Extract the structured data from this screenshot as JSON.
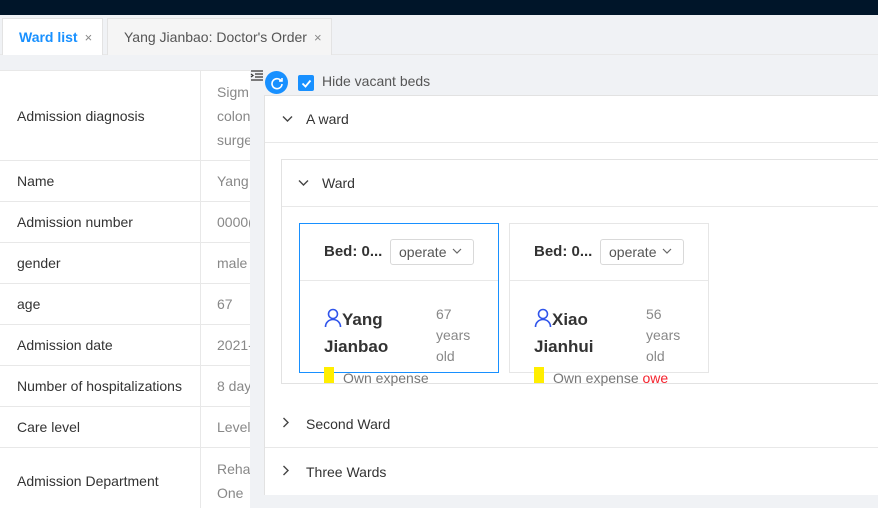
{
  "tabs": [
    {
      "label": "Ward list",
      "close": "×"
    },
    {
      "label": "Yang Jianbao: Doctor's Order",
      "close": "×"
    }
  ],
  "patient_info": {
    "rows": [
      {
        "key": "Admission diagnosis",
        "value_lines": [
          "Sigm",
          "colon",
          "surge"
        ]
      },
      {
        "key": "Name",
        "value": "Yang"
      },
      {
        "key": "Admission number",
        "value": "0000("
      },
      {
        "key": "gender",
        "value": "male"
      },
      {
        "key": "age",
        "value": "67"
      },
      {
        "key": "Admission date",
        "value": "2021-"
      },
      {
        "key": "Number of hospitalizations",
        "value": "8 day"
      },
      {
        "key": "Care level",
        "value": "Level"
      },
      {
        "key": "Admission Department",
        "value_lines": [
          "Reha",
          "One"
        ]
      }
    ]
  },
  "toolbar": {
    "refresh_icon": "refresh-icon",
    "hide_vacant_label": "Hide vacant beds",
    "hide_vacant_checked": true
  },
  "wards": {
    "a_ward": {
      "label": "A ward"
    },
    "inner_ward": {
      "label": "Ward"
    },
    "second_ward": {
      "label": "Second Ward"
    },
    "three_wards": {
      "label": "Three Wards"
    }
  },
  "beds": [
    {
      "bed_label": "Bed: 0...",
      "operate_label": "operate",
      "name": "Yang Jianbao",
      "age": "67 years old",
      "expense": "Own expense",
      "owe": ""
    },
    {
      "bed_label": "Bed: 0...",
      "operate_label": "operate",
      "name": "Xiao Jianhui",
      "age": "56 years old",
      "expense": "Own expense",
      "owe": "owe"
    }
  ],
  "colors": {
    "accent": "#1890ff",
    "owe": "#f5222d",
    "expense_mark": "#ffee00",
    "topbar": "#001529"
  }
}
